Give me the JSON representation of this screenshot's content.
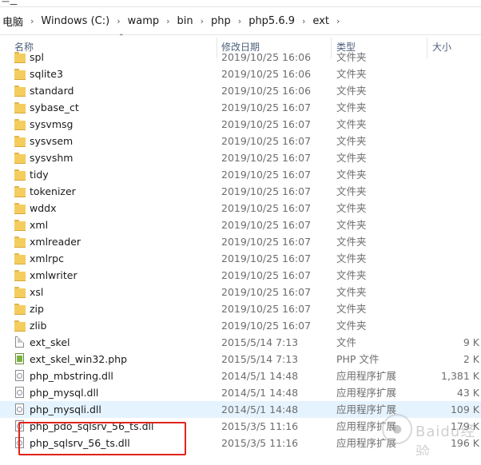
{
  "address_bar": {
    "crumbs": [
      "电脑",
      "Windows (C:)",
      "wamp",
      "bin",
      "php",
      "php5.6.9",
      "ext"
    ]
  },
  "columns": {
    "name": "名称",
    "date": "修改日期",
    "type": "类型",
    "size": "大小"
  },
  "rows": [
    {
      "icon": "folder",
      "name": "spl",
      "date": "2019/10/25 16:06",
      "type": "文件夹",
      "size": ""
    },
    {
      "icon": "folder",
      "name": "sqlite3",
      "date": "2019/10/25 16:06",
      "type": "文件夹",
      "size": ""
    },
    {
      "icon": "folder",
      "name": "standard",
      "date": "2019/10/25 16:06",
      "type": "文件夹",
      "size": ""
    },
    {
      "icon": "folder",
      "name": "sybase_ct",
      "date": "2019/10/25 16:07",
      "type": "文件夹",
      "size": ""
    },
    {
      "icon": "folder",
      "name": "sysvmsg",
      "date": "2019/10/25 16:07",
      "type": "文件夹",
      "size": ""
    },
    {
      "icon": "folder",
      "name": "sysvsem",
      "date": "2019/10/25 16:07",
      "type": "文件夹",
      "size": ""
    },
    {
      "icon": "folder",
      "name": "sysvshm",
      "date": "2019/10/25 16:07",
      "type": "文件夹",
      "size": ""
    },
    {
      "icon": "folder",
      "name": "tidy",
      "date": "2019/10/25 16:07",
      "type": "文件夹",
      "size": ""
    },
    {
      "icon": "folder",
      "name": "tokenizer",
      "date": "2019/10/25 16:07",
      "type": "文件夹",
      "size": ""
    },
    {
      "icon": "folder",
      "name": "wddx",
      "date": "2019/10/25 16:07",
      "type": "文件夹",
      "size": ""
    },
    {
      "icon": "folder",
      "name": "xml",
      "date": "2019/10/25 16:07",
      "type": "文件夹",
      "size": ""
    },
    {
      "icon": "folder",
      "name": "xmlreader",
      "date": "2019/10/25 16:07",
      "type": "文件夹",
      "size": ""
    },
    {
      "icon": "folder",
      "name": "xmlrpc",
      "date": "2019/10/25 16:07",
      "type": "文件夹",
      "size": ""
    },
    {
      "icon": "folder",
      "name": "xmlwriter",
      "date": "2019/10/25 16:07",
      "type": "文件夹",
      "size": ""
    },
    {
      "icon": "folder",
      "name": "xsl",
      "date": "2019/10/25 16:07",
      "type": "文件夹",
      "size": ""
    },
    {
      "icon": "folder",
      "name": "zip",
      "date": "2019/10/25 16:07",
      "type": "文件夹",
      "size": ""
    },
    {
      "icon": "folder",
      "name": "zlib",
      "date": "2019/10/25 16:07",
      "type": "文件夹",
      "size": ""
    },
    {
      "icon": "file",
      "name": "ext_skel",
      "date": "2015/5/14 7:13",
      "type": "文件",
      "size": "9 K"
    },
    {
      "icon": "php",
      "name": "ext_skel_win32.php",
      "date": "2015/5/14 7:13",
      "type": "PHP 文件",
      "size": "2 K"
    },
    {
      "icon": "dll",
      "name": "php_mbstring.dll",
      "date": "2014/5/1 14:48",
      "type": "应用程序扩展",
      "size": "1,381 K"
    },
    {
      "icon": "dll",
      "name": "php_mysql.dll",
      "date": "2014/5/1 14:48",
      "type": "应用程序扩展",
      "size": "43 K"
    },
    {
      "icon": "dll",
      "name": "php_mysqli.dll",
      "date": "2014/5/1 14:48",
      "type": "应用程序扩展",
      "size": "109 K",
      "selected": true
    },
    {
      "icon": "dll",
      "name": "php_pdo_sqlsrv_56_ts.dll",
      "date": "2015/3/5 11:16",
      "type": "应用程序扩展",
      "size": "179 K"
    },
    {
      "icon": "dll",
      "name": "php_sqlsrv_56_ts.dll",
      "date": "2015/3/5 11:16",
      "type": "应用程序扩展",
      "size": "196 K"
    }
  ],
  "watermark": {
    "text": "Baidu经验"
  },
  "colors": {
    "selected_row": "#e5f3ff",
    "annotation": "#e0231a",
    "header_text": "#4c607a",
    "folder": "#f4cd5e"
  }
}
